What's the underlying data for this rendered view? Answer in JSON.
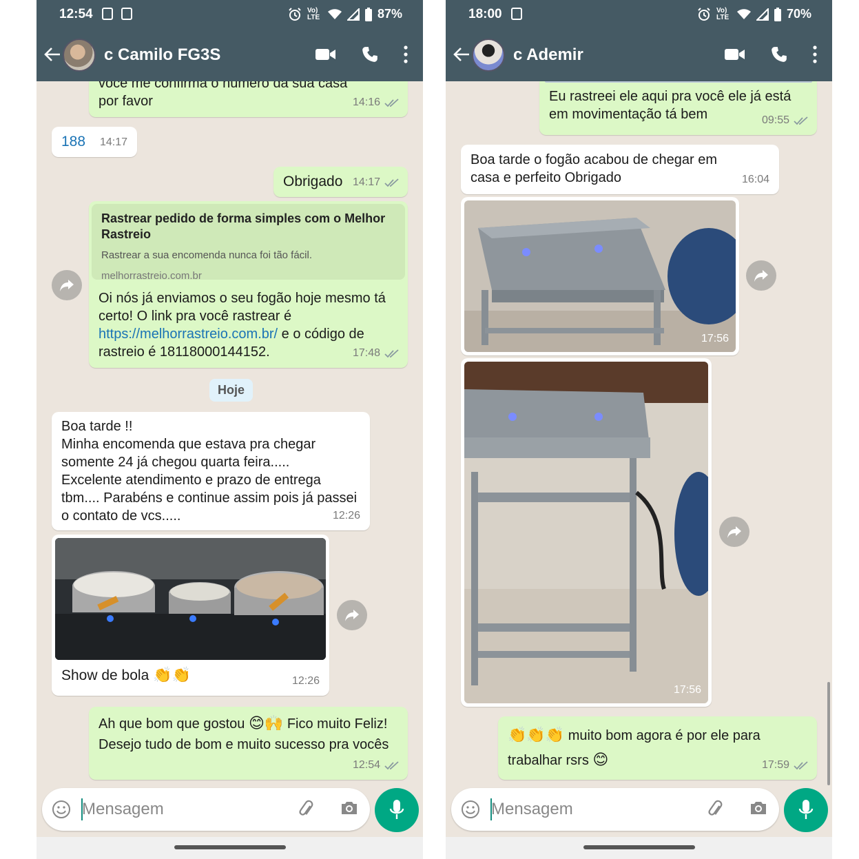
{
  "left": {
    "status": {
      "time": "12:54",
      "battery": "87%",
      "network": "Vo) LTE"
    },
    "header": {
      "contact": "c Camilo FG3S"
    },
    "messages": {
      "m1": {
        "text_line1": "voce me confirma o numero da sua casa",
        "text_line2": "por favor",
        "time": "14:16"
      },
      "m2": {
        "text": "188",
        "time": "14:17"
      },
      "m3": {
        "text": "Obrigado",
        "time": "14:17"
      },
      "m4": {
        "preview_title": "Rastrear pedido de forma simples com o Melhor Rastreio",
        "preview_desc": "Rastrear a sua encomenda nunca foi tão fácil.",
        "preview_domain": "melhorrastreio.com.br",
        "text_before": "Oi nós já enviamos o seu fogão hoje mesmo tá certo! O link pra você rastrear é ",
        "link": "https://melhorrastreio.com.br/",
        "text_after": " e o código de rastreio é 18118000144152.",
        "time": "17:48"
      },
      "day_chip": "Hoje",
      "m5": {
        "text": "Boa tarde !!\nMinha encomenda que estava pra chegar somente 24 já chegou quarta feira.....\nExcelente atendimento e prazo de entrega tbm.... Parabéns e continue assim pois já passei o contato de vcs.....",
        "time": "12:26"
      },
      "m6": {
        "caption": "Show de bola",
        "emoji": "👏👏",
        "time": "12:26"
      },
      "m7": {
        "text_a": "Ah que bom que gostou ",
        "emoji_a": "😊🙌",
        "text_b": " Fico muito Feliz! Desejo tudo de bom e muito sucesso pra vocês",
        "time": "12:54"
      }
    },
    "input": {
      "placeholder": "Mensagem"
    }
  },
  "right": {
    "status": {
      "time": "18:00",
      "battery": "70%",
      "network": "Vo) LTE"
    },
    "header": {
      "contact": "c Ademir"
    },
    "messages": {
      "m1": {
        "text": "Eu rastreei ele aqui pra você ele já está em movimentação tá bem",
        "time": "09:55"
      },
      "m2": {
        "text": "Boa tarde o fogão acabou de chegar em casa e perfeito Obrigado",
        "time": "16:04"
      },
      "m3": {
        "time": "17:56"
      },
      "m4": {
        "time": "17:56"
      },
      "m5": {
        "emoji_a": "👏👏👏",
        "text": " muito bom agora é por ele para trabalhar rsrs ",
        "emoji_b": "😊",
        "time": "17:59"
      }
    },
    "input": {
      "placeholder": "Mensagem"
    }
  },
  "colors": {
    "header": "#455a64",
    "outgoing": "#dcf8c6",
    "incoming": "#ffffff",
    "chat_bg": "#ece5dd",
    "accent": "#00a884",
    "link": "#1a73b5"
  },
  "icons": [
    "back-arrow-icon",
    "video-call-icon",
    "phone-icon",
    "more-vert-icon",
    "alarm-icon",
    "wifi-icon",
    "signal-icon",
    "battery-icon",
    "double-check-icon",
    "forward-icon",
    "emoji-icon",
    "attach-icon",
    "camera-icon",
    "mic-icon"
  ]
}
